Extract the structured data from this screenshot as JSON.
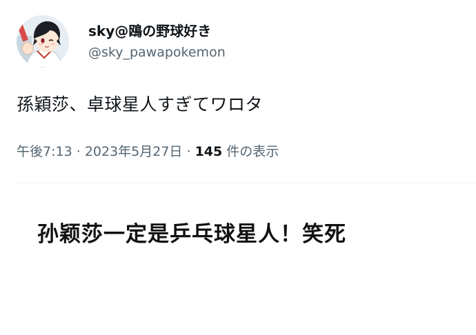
{
  "tweet": {
    "display_name": "sky@鴎の野球好き",
    "handle": "@sky_pawapokemon",
    "text": "孫穎莎、卓球星人すぎてワロタ",
    "time": "午後7:13",
    "date": "2023年5月27日",
    "separator": "·",
    "views_count": "145",
    "views_label": "件の表示"
  },
  "caption": "孙颖莎一定是乒乓球星人！笑死",
  "icons": {
    "avatar": "anime-baseball-player-avatar"
  }
}
